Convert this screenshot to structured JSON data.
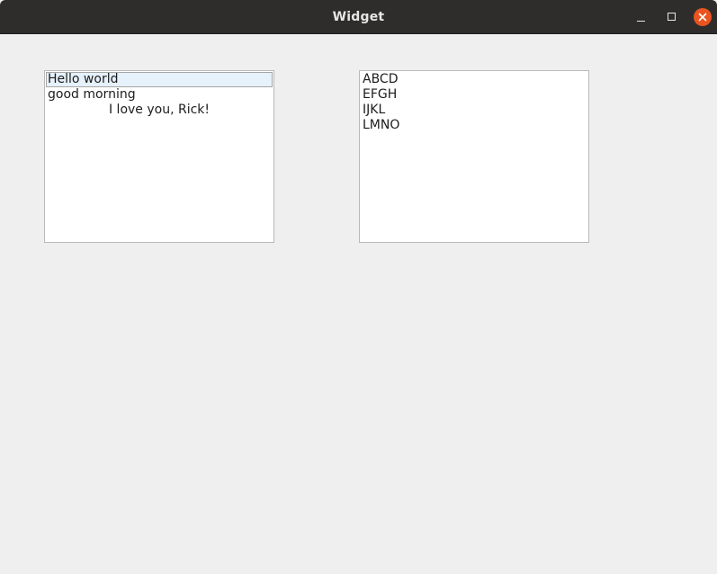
{
  "window": {
    "title": "Widget"
  },
  "left_list": {
    "items": [
      {
        "text": "Hello world",
        "current": true,
        "align": "left"
      },
      {
        "text": "good morning",
        "current": false,
        "align": "left"
      },
      {
        "text": "I love you, Rick!",
        "current": false,
        "align": "center"
      }
    ]
  },
  "right_list": {
    "items": [
      {
        "text": "ABCD"
      },
      {
        "text": "EFGH"
      },
      {
        "text": "IJKL"
      },
      {
        "text": "LMNO"
      }
    ]
  },
  "colors": {
    "titlebar": "#2f2d2c",
    "close_button": "#e95420",
    "background": "#efefef",
    "selection": "#e5f1fb"
  }
}
